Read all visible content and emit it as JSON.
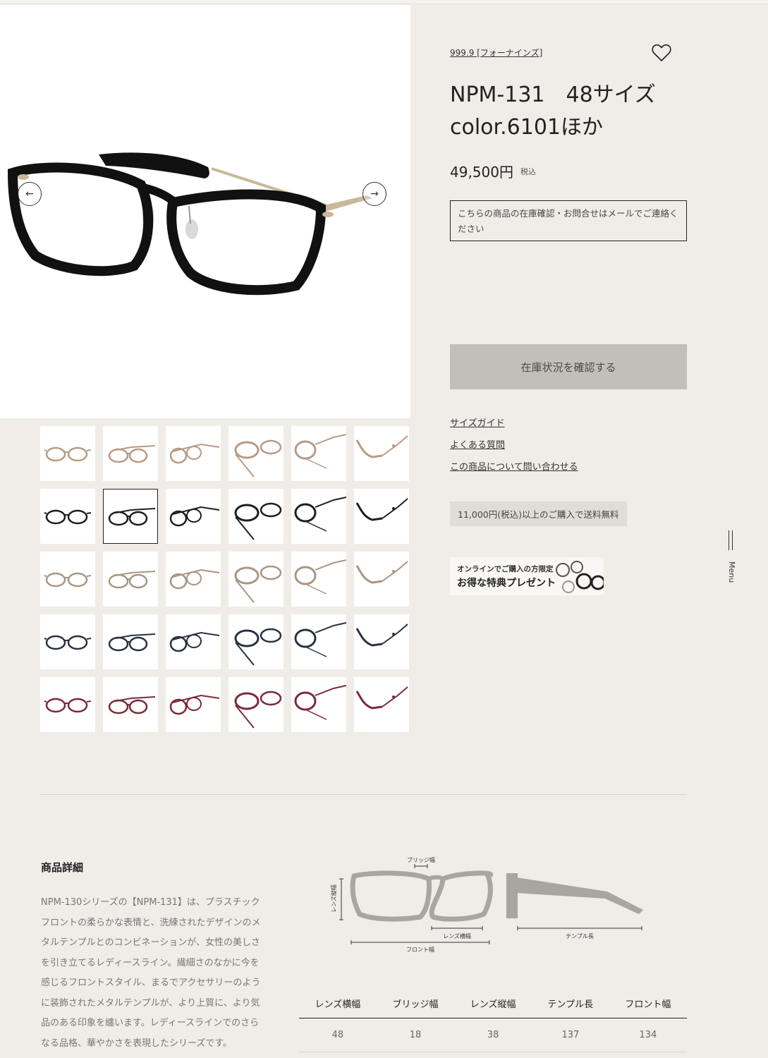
{
  "product": {
    "brand": "999.9 [フォーナインズ]",
    "title": "NPM-131　48サイズ color.6101ほか",
    "price": "49,500円",
    "tax_label": "税込",
    "notice": "こちらの商品の在庫確認・お問合せはメールでご連絡ください",
    "stock_button": "在庫状況を確認する"
  },
  "links": {
    "size_guide": "サイズガイド",
    "faq": "よくある質問",
    "inquiry": "この商品について問い合わせる"
  },
  "shipping": "11,000円(税込)以上のご購入で送料無料",
  "banner": {
    "line1": "オンラインでご購入の方限定",
    "line2": "お得な特典プレゼント"
  },
  "menu_label": "Menu",
  "icons": {
    "favorite": "heart-icon",
    "prev": "arrow-left-icon",
    "next": "arrow-right-icon",
    "menu": "menu-icon"
  },
  "thumbnails": {
    "rows": [
      {
        "color": "#b89a84"
      },
      {
        "color": "#1e1e1e"
      },
      {
        "color": "#a89682"
      },
      {
        "color": "#2a3240"
      },
      {
        "color": "#7a2a3a"
      }
    ],
    "selected_row": 1,
    "selected_col": 1
  },
  "details": {
    "heading": "商品詳細",
    "description": "NPM-130シリーズの【NPM-131】は、プラスチックフロントの柔らかな表情と、洗練されたデザインのメタルテンプルとのコンビネーションが、女性の美しさを引き立てるレディースライン。繊細さのなかに今を感じるフロントスタイル、まるでアクセサリーのように装飾されたメタルテンプルが、より上質に、より気品のある印象を纏います。レディースラインでのさらなる品格、華やかさを表現したシリーズです。"
  },
  "diagram": {
    "bridge": "ブリッジ幅",
    "lens_height": "レンズ縦幅",
    "lens_width": "レンズ横幅",
    "front": "フロント幅",
    "temple": "テンプル長"
  },
  "specs": {
    "headers": [
      "レンズ横幅",
      "ブリッジ幅",
      "レンズ縦幅",
      "テンプル長",
      "フロント幅"
    ],
    "values": [
      "48",
      "18",
      "38",
      "137",
      "134"
    ]
  }
}
